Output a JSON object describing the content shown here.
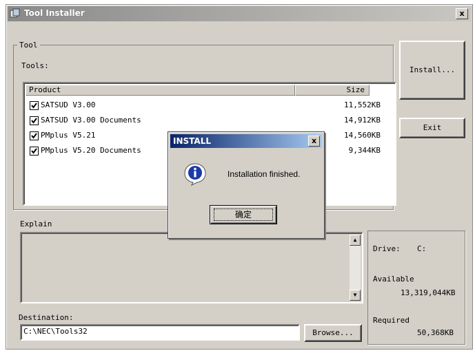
{
  "window": {
    "title": "Tool Installer",
    "close_glyph": "x"
  },
  "tool_group": {
    "title": "Tool",
    "tools_label": "Tools:"
  },
  "list": {
    "columns": [
      "Product",
      "Size"
    ],
    "rows": [
      {
        "name": "SATSUD V3.00",
        "size": "11,552KB",
        "checked": true
      },
      {
        "name": "SATSUD V3.00 Documents",
        "size": "14,912KB",
        "checked": true
      },
      {
        "name": "PMplus V5.21",
        "size": "14,560KB",
        "checked": true
      },
      {
        "name": "PMplus V5.20 Documents",
        "size": "9,344KB",
        "checked": true
      }
    ]
  },
  "buttons": {
    "install": "Install...",
    "exit": "Exit",
    "browse": "Browse..."
  },
  "explain": {
    "label": "Explain",
    "text": ""
  },
  "destination": {
    "label": "Destination:",
    "value": "C:\\NEC\\Tools32"
  },
  "drive_info": {
    "drive_label": "Drive:",
    "drive_value": "C:",
    "available_label": "Available",
    "available_value": "13,319,044KB",
    "required_label": "Required",
    "required_value": "50,368KB"
  },
  "dialog": {
    "title": "INSTALL",
    "message": "Installation finished.",
    "ok_label": "确定",
    "icon": "information-icon"
  },
  "colors": {
    "dialog_title": "#0a246a",
    "face": "#d4d0c8",
    "info_icon": "#1c3aa9"
  }
}
